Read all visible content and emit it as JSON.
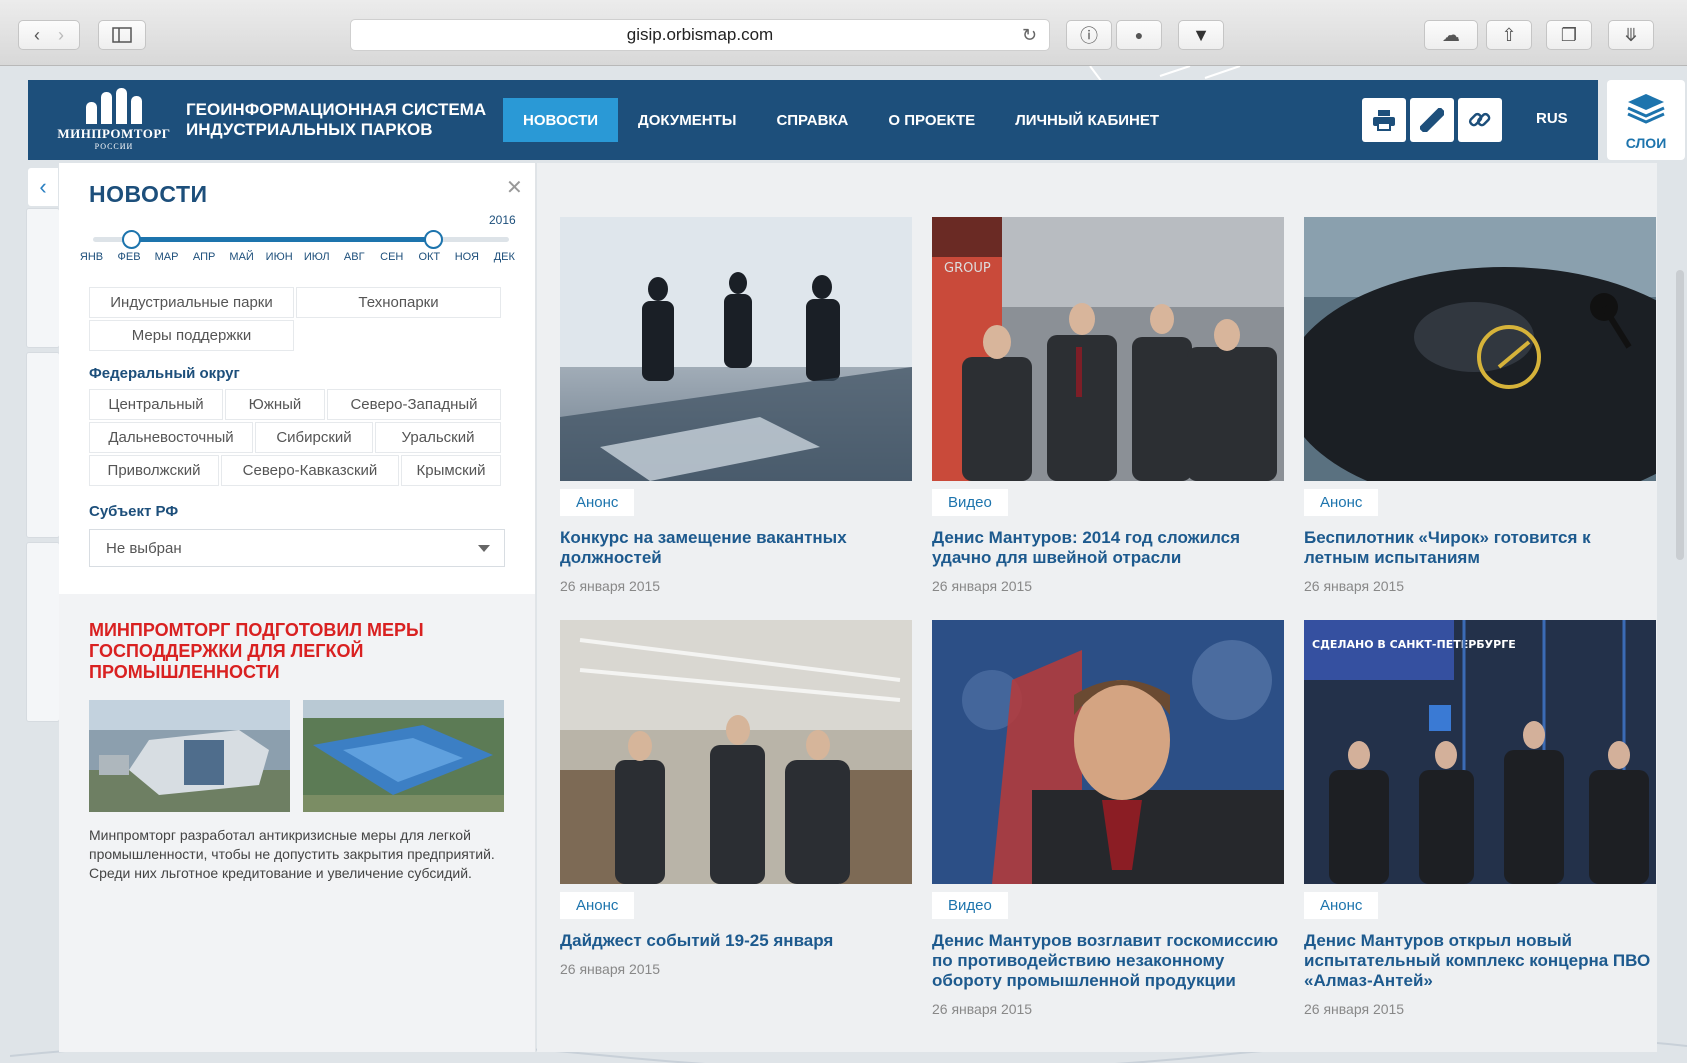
{
  "browser": {
    "url": "gisip.orbismap.com"
  },
  "header": {
    "logo_name": "МИНПРОМТОРГ",
    "logo_sub": "РОССИИ",
    "system_title_line1": "ГЕОИНФОРМАЦИОННАЯ СИСТЕМА",
    "system_title_line2": "ИНДУСТРИАЛЬНЫХ ПАРКОВ",
    "nav": [
      "НОВОСТИ",
      "ДОКУМЕНТЫ",
      "СПРАВКА",
      "О ПРОЕКТЕ",
      "ЛИЧНЫЙ КАБИНЕТ"
    ],
    "lang": "RUS",
    "layers_label": "СЛОИ"
  },
  "filters": {
    "title": "НОВОСТИ",
    "year": "2016",
    "months": [
      "ЯНВ",
      "ФЕВ",
      "МАР",
      "АПР",
      "МАЙ",
      "ИЮН",
      "ИЮЛ",
      "АВГ",
      "СЕН",
      "ОКТ",
      "НОЯ",
      "ДЕК"
    ],
    "range_start_month_index": 1,
    "range_end_month_index": 9,
    "categories": [
      "Индустриальные парки",
      "Технопарки",
      "Меры поддержки"
    ],
    "district_label": "Федеральный округ",
    "districts": [
      "Центральный",
      "Южный",
      "Северо-Западный",
      "Дальневосточный",
      "Сибирский",
      "Уральский",
      "Приволжский",
      "Северо-Кавказский",
      "Крымский"
    ],
    "subject_label": "Субъект РФ",
    "subject_value": "Не выбран"
  },
  "promo": {
    "title": "МИНПРОМТОРГ ПОДГОТОВИЛ МЕРЫ ГОСПОДДЕРЖКИ ДЛЯ ЛЕГКОЙ ПРОМЫШЛЕННОСТИ",
    "text": "Минпромторг разработал антикризисные меры для легкой промышленности, чтобы не допустить закрытия предприятий. Среди них льготное кредитование и увеличение субсидий."
  },
  "news": [
    {
      "tag": "Анонс",
      "title": "Конкурс на замещение вакантных должностей",
      "date": "26 января 2015"
    },
    {
      "tag": "Видео",
      "title": "Денис Мантуров: 2014 год сложился удачно для швейной отрасли",
      "date": "26 января 2015"
    },
    {
      "tag": "Анонс",
      "title": "Беспилотник «Чирок» готовится к летным испытаниям",
      "date": "26 января 2015"
    },
    {
      "tag": "Анонс",
      "title": "Дайджест событий 19-25 января",
      "date": "26 января 2015"
    },
    {
      "tag": "Видео",
      "title": "Денис Мантуров возглавит госкомиссию по противодействию незаконному обороту промышленной продукции",
      "date": "26 января 2015"
    },
    {
      "tag": "Анонс",
      "title": "Денис Мантуров открыл новый испытательный комплекс концерна ПВО «Алмаз-Антей»",
      "date": "26 января 2015"
    }
  ],
  "image_texts": {
    "group_sign": "GROUP",
    "sign_spb": "СДЕЛАНО В САНКТ-ПЕТЕРБУРГЕ"
  },
  "colors": {
    "header_bg": "#1d4f7b",
    "nav_active": "#2a99d6",
    "accent_link": "#1d5a8e",
    "promo_red": "#d92121"
  }
}
